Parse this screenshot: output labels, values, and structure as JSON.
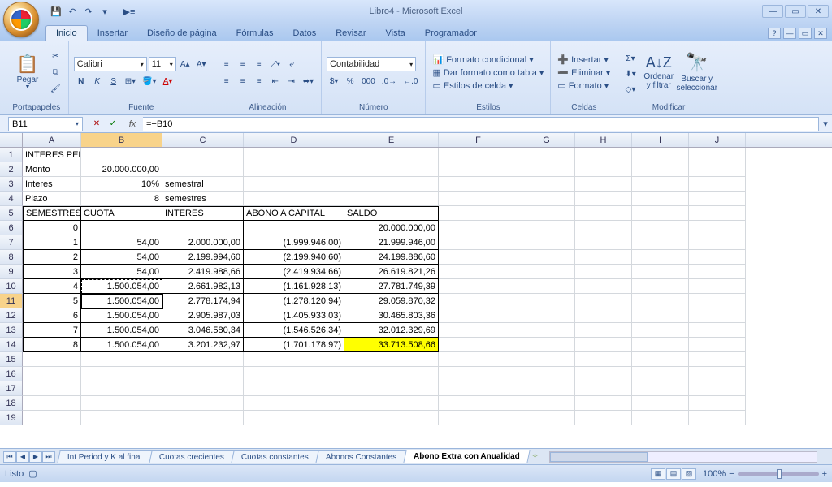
{
  "app": {
    "title": "Libro4 - Microsoft Excel"
  },
  "tabs": [
    "Inicio",
    "Insertar",
    "Diseño de página",
    "Fórmulas",
    "Datos",
    "Revisar",
    "Vista",
    "Programador"
  ],
  "activeTab": 0,
  "ribbon": {
    "clipboard": {
      "label": "Portapapeles",
      "paste": "Pegar"
    },
    "font": {
      "label": "Fuente",
      "family": "Calibri",
      "size": "11"
    },
    "align": {
      "label": "Alineación"
    },
    "number": {
      "label": "Número",
      "format": "Contabilidad"
    },
    "styles": {
      "label": "Estilos",
      "condfmt": "Formato condicional",
      "tablefmt": "Dar formato como tabla",
      "cellstyles": "Estilos de celda"
    },
    "cells": {
      "label": "Celdas",
      "insert": "Insertar",
      "delete": "Eliminar",
      "format": "Formato"
    },
    "editing": {
      "label": "Modificar",
      "sortfilter": "Ordenar y filtrar",
      "findselect": "Buscar y seleccionar"
    }
  },
  "formula": {
    "cellref": "B11",
    "value": "=+B10"
  },
  "columns": [
    "A",
    "B",
    "C",
    "D",
    "E",
    "F",
    "G",
    "H",
    "I",
    "J"
  ],
  "grid": {
    "header_row": "INTERES PERIODICO Y CAPITAL AL FINAL",
    "monto_label": "Monto",
    "monto_val": "20.000.000,00",
    "interes_label": "Interes",
    "interes_val": "10%",
    "interes_unit": "semestral",
    "plazo_label": "Plazo",
    "plazo_val": "8",
    "plazo_unit": "semestres",
    "col_headers": [
      "SEMESTRES",
      "CUOTA",
      "INTERES",
      "ABONO A CAPITAL",
      "SALDO"
    ],
    "rows": [
      {
        "sem": "0",
        "cuota": "",
        "interes": "",
        "abono": "",
        "saldo": "20.000.000,00"
      },
      {
        "sem": "1",
        "cuota": "54,00",
        "interes": "2.000.000,00",
        "abono": "(1.999.946,00)",
        "saldo": "21.999.946,00"
      },
      {
        "sem": "2",
        "cuota": "54,00",
        "interes": "2.199.994,60",
        "abono": "(2.199.940,60)",
        "saldo": "24.199.886,60"
      },
      {
        "sem": "3",
        "cuota": "54,00",
        "interes": "2.419.988,66",
        "abono": "(2.419.934,66)",
        "saldo": "26.619.821,26"
      },
      {
        "sem": "4",
        "cuota": "1.500.054,00",
        "interes": "2.661.982,13",
        "abono": "(1.161.928,13)",
        "saldo": "27.781.749,39"
      },
      {
        "sem": "5",
        "cuota": "1.500.054,00",
        "interes": "2.778.174,94",
        "abono": "(1.278.120,94)",
        "saldo": "29.059.870,32"
      },
      {
        "sem": "6",
        "cuota": "1.500.054,00",
        "interes": "2.905.987,03",
        "abono": "(1.405.933,03)",
        "saldo": "30.465.803,36"
      },
      {
        "sem": "7",
        "cuota": "1.500.054,00",
        "interes": "3.046.580,34",
        "abono": "(1.546.526,34)",
        "saldo": "32.012.329,69"
      },
      {
        "sem": "8",
        "cuota": "1.500.054,00",
        "interes": "3.201.232,97",
        "abono": "(1.701.178,97)",
        "saldo": "33.713.508,66"
      }
    ]
  },
  "sheets": [
    "Int Period y K al final",
    "Cuotas crecientes",
    "Cuotas constantes",
    "Abonos Constantes",
    "Abono Extra con Anualidad"
  ],
  "activeSheet": 4,
  "status": {
    "ready": "Listo",
    "zoom": "100%"
  }
}
